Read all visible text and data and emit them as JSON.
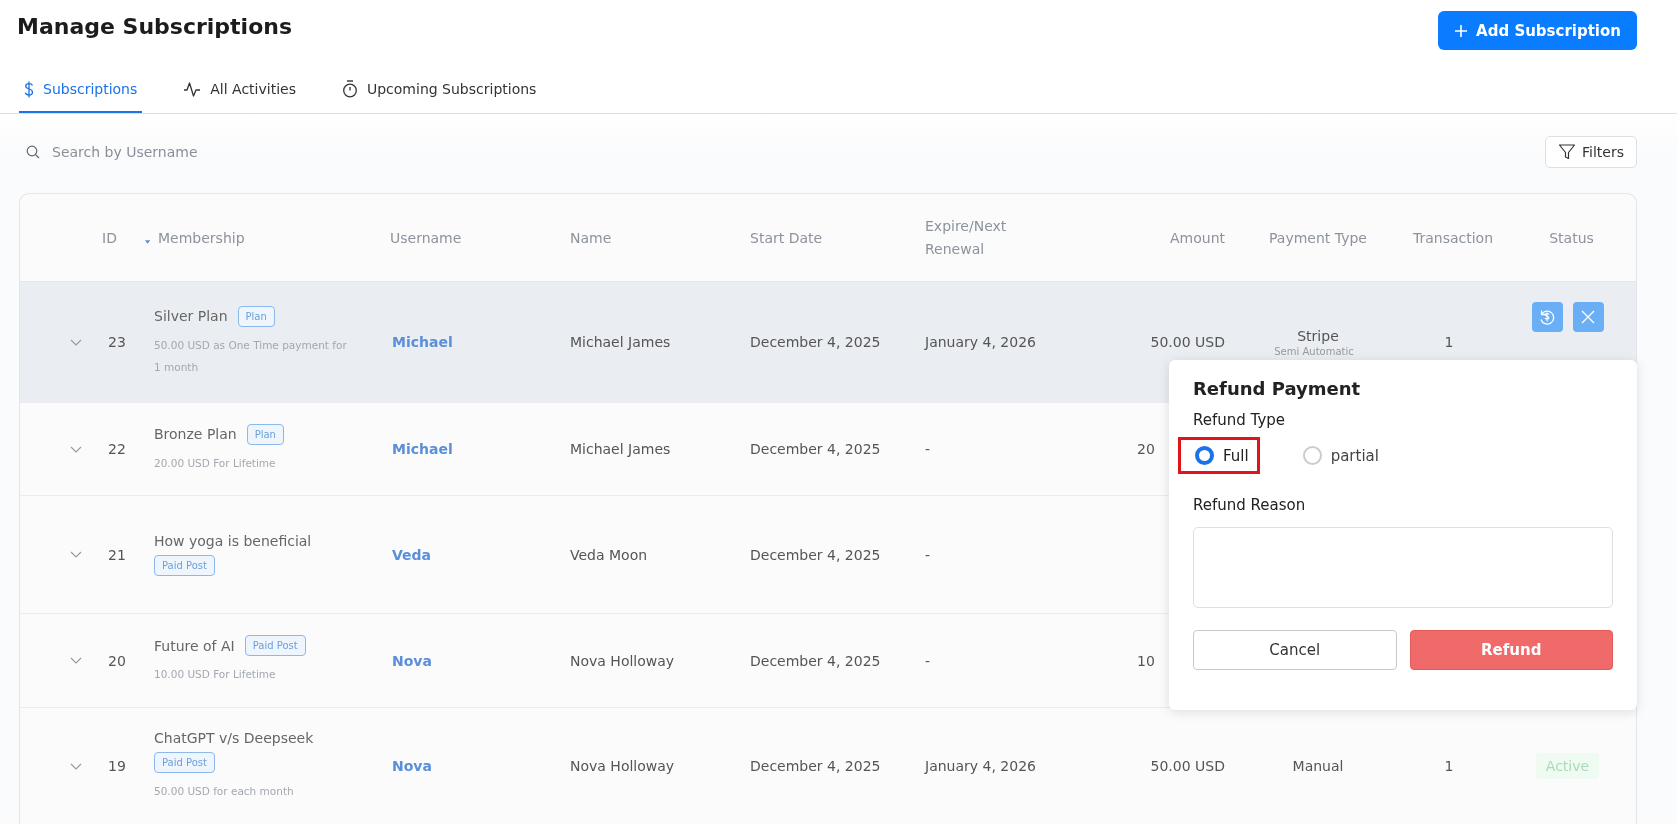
{
  "page": {
    "title": "Manage Subscriptions",
    "add_button": "Add Subscription"
  },
  "tabs": [
    {
      "label": "Subscriptions",
      "selected": true
    },
    {
      "label": "All Activities",
      "selected": false
    },
    {
      "label": "Upcoming Subscriptions",
      "selected": false
    }
  ],
  "search": {
    "placeholder": "Search by Username"
  },
  "filters_button": "Filters",
  "table": {
    "columns": [
      "ID",
      "Membership",
      "Username",
      "Name",
      "Start Date",
      "Expire/Next Renewal",
      "Amount",
      "Payment Type",
      "Transaction",
      "Status"
    ],
    "rows": [
      {
        "id": "23",
        "title": "Silver Plan",
        "tag": "Plan",
        "description": "50.00 USD as One Time payment for 1 month",
        "username": "Michael",
        "name": "Michael James",
        "start": "December 4, 2025",
        "expire": "January 4, 2026",
        "amount": "50.00 USD",
        "payment": "Stripe",
        "payment_note": "Semi Automatic",
        "transaction": "1",
        "status": {
          "kind": "actions"
        },
        "highlighted": true
      },
      {
        "id": "22",
        "title": "Bronze Plan",
        "tag": "Plan",
        "description": "20.00 USD For Lifetime",
        "username": "Michael",
        "name": "Michael James",
        "start": "December 4, 2025",
        "expire": "-",
        "amount_partial": "20",
        "highlighted": false
      },
      {
        "id": "21",
        "title": "How yoga is beneficial",
        "tag": "Paid Post",
        "username": "Veda",
        "name": "Veda Moon",
        "start": "December 4, 2025",
        "expire": "-",
        "highlighted": false
      },
      {
        "id": "20",
        "title": "Future of AI",
        "tag": "Paid Post",
        "description": "10.00 USD For Lifetime",
        "username": "Nova",
        "name": "Nova Holloway",
        "start": "December 4, 2025",
        "expire": "-",
        "amount_partial": "10",
        "highlighted": false
      },
      {
        "id": "19",
        "title": "ChatGPT v/s Deepseek",
        "tag": "Paid Post",
        "description": "50.00 USD for each month",
        "username": "Nova",
        "name": "Nova Holloway",
        "start": "December 4, 2025",
        "expire": "January 4, 2026",
        "amount": "50.00 USD",
        "payment": "Manual",
        "transaction": "1",
        "status": {
          "kind": "badge",
          "label": "Active"
        },
        "highlighted": false
      }
    ]
  },
  "refund_dialog": {
    "title": "Refund Payment",
    "type_label": "Refund Type",
    "options": [
      {
        "label": "Full",
        "selected": true,
        "color": "#e0151b"
      },
      {
        "label": "partial",
        "selected": false
      }
    ],
    "reason_label": "Refund Reason",
    "cancel": "Cancel",
    "confirm": "Refund"
  }
}
